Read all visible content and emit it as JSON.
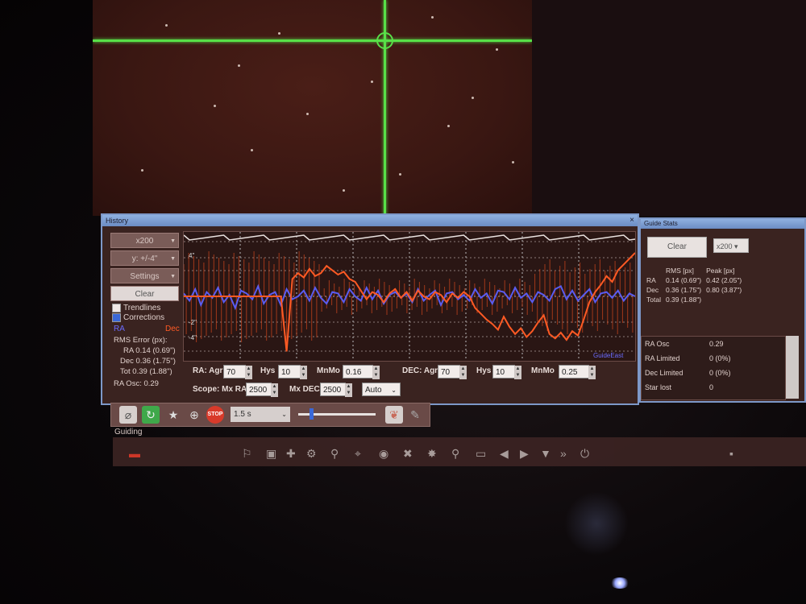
{
  "history": {
    "title": "History",
    "buttons": {
      "scale": "x200",
      "y_scale": "y: +/-4\"",
      "settings": "Settings",
      "clear": "Clear"
    },
    "checkboxes": {
      "trendlines": "Trendlines",
      "corrections": "Corrections"
    },
    "legend": {
      "ra": "RA",
      "dec": "Dec"
    },
    "rms_title": "RMS Error (px):",
    "rms": {
      "ra": "RA 0.14 (0.69\")",
      "dec": "Dec 0.36 (1.75\")",
      "tot": "Tot 0.39 (1.88\")",
      "ra_osc": "RA Osc: 0.29"
    },
    "graph_labels": {
      "y_top": "4\"",
      "y_mid1": "2\"",
      "y_mid2": "-2\"",
      "y_bot": "-4\"",
      "corner": "GuideEast"
    },
    "params": {
      "ra_agr_label": "RA: Agr",
      "ra_agr": "70",
      "ra_hys_label": "Hys",
      "ra_hys": "10",
      "ra_mnmo_label": "MnMo",
      "ra_mnmo": "0.16",
      "dec_agr_label": "DEC: Agr",
      "dec_agr": "70",
      "dec_hys_label": "Hys",
      "dec_hys": "10",
      "dec_mnmo_label": "MnMo",
      "dec_mnmo": "0.25",
      "scope_label": "Scope: Mx RA",
      "mx_ra": "2500",
      "mx_dec_label": "Mx DEC",
      "mx_dec": "2500",
      "dec_mode": "Auto"
    }
  },
  "stats": {
    "title": "Guide Stats",
    "clear": "Clear",
    "scale": "x200",
    "headers": [
      "",
      "RMS [px]",
      "Peak [px]"
    ],
    "rows": [
      [
        "RA",
        "0.14 (0.69\")",
        "0.42 (2.05\")"
      ],
      [
        "Dec",
        "0.36 (1.75\")",
        "0.80 (3.87\")"
      ],
      [
        "Total",
        "0.39 (1.88\")",
        ""
      ]
    ],
    "lower": [
      [
        "RA Osc",
        "0.29"
      ],
      [
        "RA Limited",
        "0 (0%)"
      ],
      [
        "Dec Limited",
        "0 (0%)"
      ],
      [
        "Star lost",
        "0"
      ]
    ]
  },
  "toolbar": {
    "exposure": "1.5 s",
    "icons": [
      "loop-icon",
      "refresh-icon",
      "star-icon",
      "crosshair-icon",
      "stop-icon",
      "brain-icon",
      "tools-icon"
    ]
  },
  "guiding_label": "Guiding",
  "colors": {
    "ra": "#5a5cf0",
    "dec": "#ff5a24",
    "crosshair": "#58e048",
    "accent": "#3a68d8"
  },
  "series": {
    "ra": [
      0.2,
      -0.3,
      0.5,
      -0.6,
      0.3,
      -0.1,
      0.6,
      -0.4,
      0.1,
      -0.8,
      0.4,
      0.2,
      -0.2,
      0.7,
      -0.5,
      0.1,
      0.3,
      -0.6,
      0.5,
      -0.2,
      0.0,
      0.4,
      -0.3,
      0.6,
      -0.1,
      -0.5,
      0.3,
      0.2,
      -0.4,
      0.5,
      0.0,
      -0.3,
      0.6,
      -0.2,
      0.4,
      -0.5,
      0.1,
      0.3,
      -0.1,
      0.2,
      -0.4,
      0.5,
      -0.3,
      0.1,
      0.4,
      -0.6,
      0.2,
      0.3,
      -0.2,
      0.1,
      -0.3,
      0.5,
      -0.1,
      0.2,
      -0.5,
      0.4,
      0.3,
      -0.2,
      0.6,
      -0.1,
      0.2,
      -0.4,
      0.3,
      0.1,
      -0.3,
      0.5,
      0.7,
      -0.2,
      0.4,
      -0.3,
      0.1,
      0.5,
      -0.4,
      0.2,
      0.3,
      -0.1,
      0.4,
      -0.3,
      0.2,
      0.0
    ],
    "dec": [
      0.0,
      0.0,
      0.0,
      0.0,
      0.0,
      0.0,
      0.0,
      0.0,
      0.0,
      0.0,
      0.0,
      0.0,
      0.0,
      0.0,
      0.0,
      0.0,
      0.0,
      0.0,
      -3.8,
      1.2,
      1.6,
      1.3,
      1.9,
      1.4,
      1.6,
      2.1,
      1.8,
      1.5,
      1.7,
      1.2,
      1.0,
      0.4,
      -0.2,
      0.3,
      0.1,
      -0.4,
      0.2,
      0.5,
      -0.1,
      0.3,
      -0.3,
      0.4,
      0.0,
      -0.2,
      0.3,
      0.1,
      -0.4,
      0.2,
      -0.1,
      0.3,
      0.0,
      -0.8,
      -1.2,
      -1.6,
      -1.9,
      -2.3,
      -1.4,
      -2.1,
      -2.6,
      -2.2,
      -2.8,
      -2.4,
      -1.8,
      -1.3,
      -2.6,
      -2.9,
      -2.5,
      -3.0,
      -2.4,
      -2.7,
      -1.6,
      -0.4,
      0.3,
      0.8,
      1.4,
      1.0,
      1.8,
      2.2,
      2.6,
      3.0
    ]
  }
}
